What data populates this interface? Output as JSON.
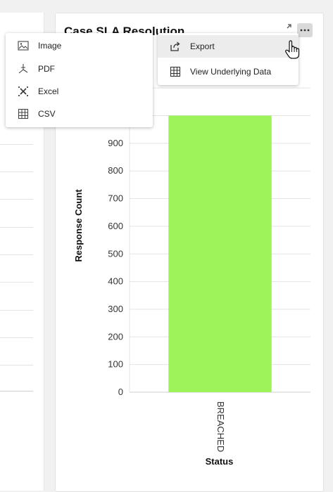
{
  "card": {
    "title": "Case SLA Resolution"
  },
  "export_menu": {
    "items": [
      {
        "label": "Export",
        "icon": "export-icon"
      },
      {
        "label": "View Underlying Data",
        "icon": "table-icon"
      }
    ]
  },
  "format_menu": {
    "items": [
      {
        "label": "Image",
        "icon": "image-icon"
      },
      {
        "label": "PDF",
        "icon": "pdf-icon"
      },
      {
        "label": "Excel",
        "icon": "excel-icon"
      },
      {
        "label": "CSV",
        "icon": "csv-icon"
      }
    ]
  },
  "colors": {
    "bar": "#9ef25a",
    "grid": "#e3e3e3"
  },
  "chart_data": {
    "type": "bar",
    "categories": [
      "BREACHED"
    ],
    "values": [
      1000
    ],
    "xlabel": "Status",
    "ylabel": "Response Count",
    "yticks": [
      0,
      100,
      200,
      300,
      400,
      500,
      600,
      700,
      800,
      900
    ],
    "ylim": [
      0,
      1100
    ],
    "grid": true
  }
}
